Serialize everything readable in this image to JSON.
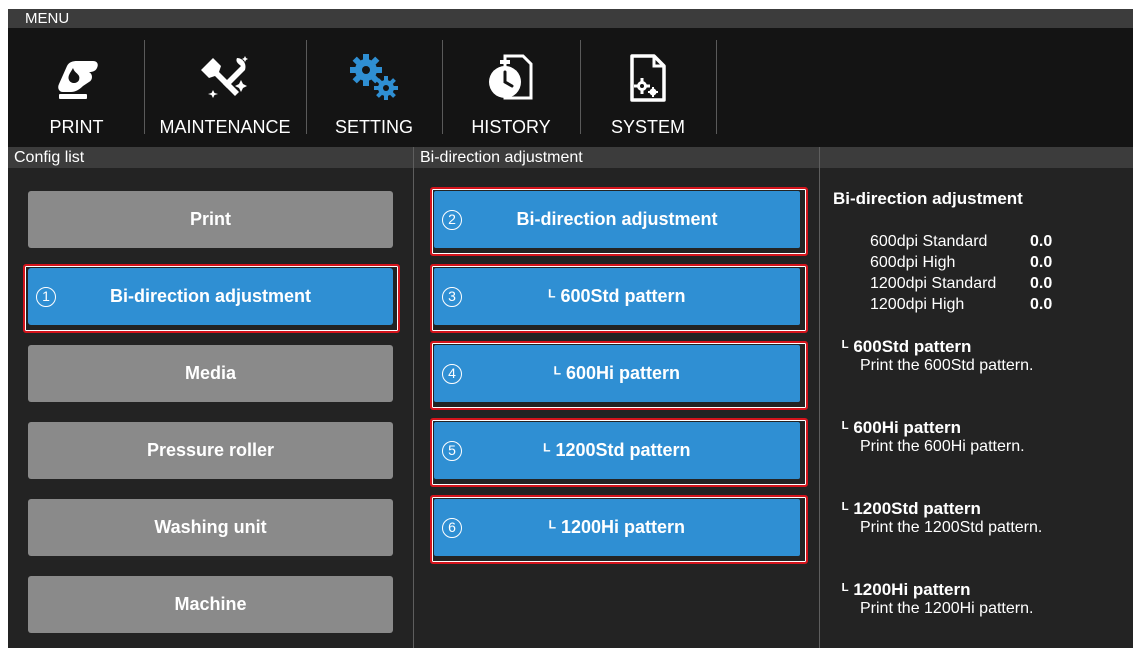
{
  "menu": {
    "title": "MENU"
  },
  "nav": [
    {
      "label": "PRINT",
      "icon": "print-icon"
    },
    {
      "label": "MAINTENANCE",
      "icon": "maintenance-tools-icon"
    },
    {
      "label": "SETTING",
      "icon": "gears-icon"
    },
    {
      "label": "HISTORY",
      "icon": "history-clock-icon"
    },
    {
      "label": "SYSTEM",
      "icon": "system-document-gear-icon"
    }
  ],
  "panels": {
    "config_list_title": "Config list",
    "adjust_title": "Bi-direction adjustment"
  },
  "config_list": [
    {
      "label": "Print",
      "selected": false
    },
    {
      "label": "Bi-direction adjustment",
      "selected": true,
      "marker": "1"
    },
    {
      "label": "Media",
      "selected": false
    },
    {
      "label": "Pressure roller",
      "selected": false
    },
    {
      "label": "Washing unit",
      "selected": false
    },
    {
      "label": "Machine",
      "selected": false
    }
  ],
  "adjust_buttons": [
    {
      "label": "Bi-direction adjustment",
      "marker": "2"
    },
    {
      "label": "ᴸ 600Std pattern",
      "marker": "3"
    },
    {
      "label": "ᴸ 600Hi pattern",
      "marker": "4"
    },
    {
      "label": "ᴸ 1200Std pattern",
      "marker": "5"
    },
    {
      "label": "ᴸ 1200Hi pattern",
      "marker": "6"
    }
  ],
  "info": {
    "title": "Bi-direction adjustment",
    "values": [
      {
        "label": "600dpi Standard",
        "value": "0.0"
      },
      {
        "label": "600dpi High",
        "value": "0.0"
      },
      {
        "label": "1200dpi Standard",
        "value": "0.0"
      },
      {
        "label": "1200dpi High",
        "value": "0.0"
      }
    ],
    "patterns": [
      {
        "title": "ᴸ 600Std pattern",
        "desc": "Print the 600Std pattern."
      },
      {
        "title": "ᴸ 600Hi pattern",
        "desc": "Print the 600Hi pattern."
      },
      {
        "title": "ᴸ 1200Std pattern",
        "desc": "Print the 1200Std pattern."
      },
      {
        "title": "ᴸ 1200Hi pattern",
        "desc": "Print the 1200Hi pattern."
      }
    ]
  },
  "colors": {
    "accent": "#2f8fd3",
    "highlight": "#d4141c",
    "button_gray": "#8a8a8a",
    "background": "#232323"
  }
}
